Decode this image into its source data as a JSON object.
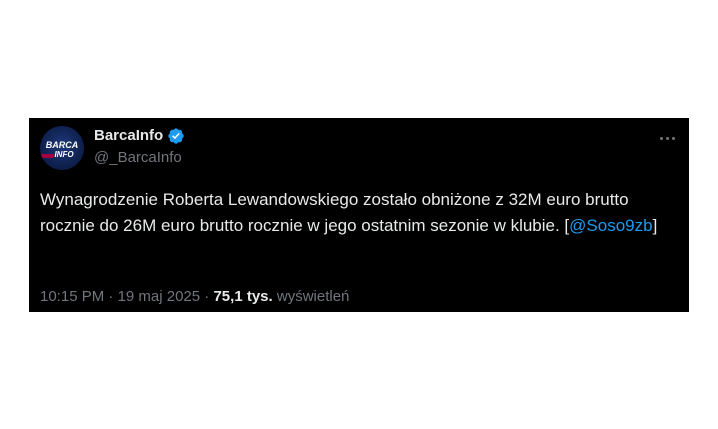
{
  "tweet": {
    "author": {
      "display_name": "BarcaInfo",
      "handle": "@_BarcaInfo",
      "verified": true,
      "avatar_text_top": "BARCA",
      "avatar_text_bottom": "INFO"
    },
    "text_main": "Wynagrodzenie Roberta Lewandowskiego zostało obniżone z 32M euro brutto rocznie do 26M euro brutto rocznie w jego ostatnim sezonie w klubie. [",
    "mention": "@Soso9zb",
    "text_end": "]",
    "time": "10:15 PM",
    "separator": "·",
    "date": "19 maj 2025",
    "views_count": "75,1 tys.",
    "views_label": "wyświetleń"
  },
  "colors": {
    "background": "#000000",
    "text": "#e7e9ea",
    "secondary": "#71767b",
    "accent": "#1d9bf0"
  },
  "icons": {
    "verified": "verified-badge-icon",
    "more": "more-options-icon"
  }
}
